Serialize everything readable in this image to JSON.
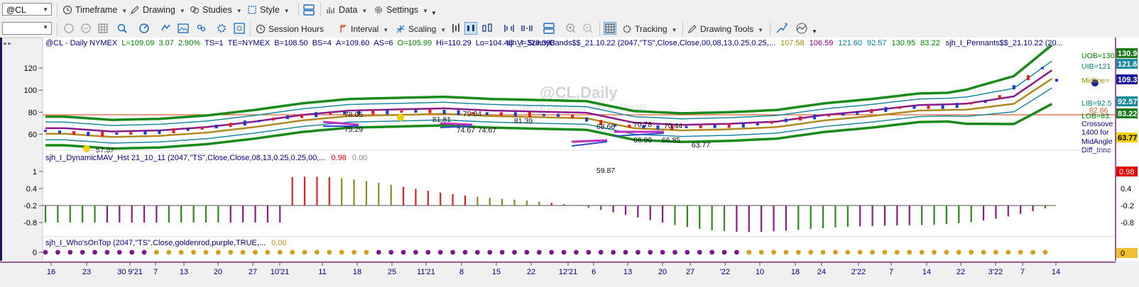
{
  "toolbar1": {
    "symbol": "@CL",
    "timeframe": "Timeframe",
    "drawing": "Drawing",
    "studies": "Studies",
    "style": "Style",
    "data": "Data",
    "settings": "Settings"
  },
  "toolbar2": {
    "session_hours": "Session Hours",
    "interval": "Interval",
    "scaling": "Scaling",
    "tracking": "Tracking",
    "drawing_tools": "Drawing Tools"
  },
  "chart": {
    "header": "@CL - Daily  NYMEX",
    "quote": [
      {
        "text": "L=109.09",
        "color": "#008000"
      },
      {
        "text": "3.07",
        "color": "#008000"
      },
      {
        "text": "2.90%",
        "color": "#008000"
      },
      {
        "text": "TS=1",
        "color": "#000080"
      },
      {
        "text": "TE=NYMEX",
        "color": "#000080"
      },
      {
        "text": "B=108.50",
        "color": "#000080"
      },
      {
        "text": "BS=4",
        "color": "#000080"
      },
      {
        "text": "A=109.60",
        "color": "#000080"
      },
      {
        "text": "AS=6",
        "color": "#000080"
      },
      {
        "text": "O=105.99",
        "color": "#008000"
      },
      {
        "text": "Hi=110.29",
        "color": "#000080"
      },
      {
        "text": "Lo=104.48",
        "color": "#000080"
      },
      {
        "text": "V=329,393",
        "color": "#000080"
      }
    ],
    "study1": "sjh_I_SunnyBands$$_21.10.22 (2047,\"TS\",Close,Close,00,08,13,0.25,0.25,...",
    "study1_values": [
      {
        "text": "107.58",
        "color": "#a09000"
      },
      {
        "text": "106.59",
        "color": "#800080"
      },
      {
        "text": "121.60",
        "color": "#0080a0"
      },
      {
        "text": "92.57",
        "color": "#0080a0"
      },
      {
        "text": "130.95",
        "color": "#008000"
      },
      {
        "text": "83.22",
        "color": "#008000"
      }
    ],
    "study1b": "sjh_I_Pennants$$_21.10.22 (20...",
    "watermark": "@CL,Daily",
    "watermark_sub": "Crude Oil Continuous Contract [Apr22]",
    "price_ticks": [
      "120",
      "100",
      "80",
      "60"
    ],
    "right_labels": [
      {
        "text": "130.9",
        "bg": "#1a7a1a"
      },
      {
        "text": "121.6",
        "bg": "#1a8aa0"
      },
      {
        "text": "109.3",
        "bg": "#1a1a9a"
      },
      {
        "text": "92.57",
        "bg": "#1a8aa0"
      },
      {
        "text": "83.22",
        "bg": "#1a7a1a"
      },
      {
        "text": "63.77",
        "bg": "#f0d000",
        "fg": "#000"
      }
    ],
    "band_labels": [
      {
        "text": "UOB=130",
        "color": "#008000"
      },
      {
        "text": "UIB=121",
        "color": "#008080"
      },
      {
        "text": "Midline=",
        "color": "#a09000"
      },
      {
        "text": "LIB=92.5",
        "color": "#008080"
      },
      {
        "text": "82.86",
        "color": "#e06030"
      },
      {
        "text": "LOB=83.",
        "color": "#008000"
      },
      {
        "text": "Crossove",
        "color": "#000080"
      },
      {
        "text": "1400 for",
        "color": "#000080"
      },
      {
        "text": "MidAngle",
        "color": "#000080"
      },
      {
        "text": "Diff_Inne",
        "color": "#000080"
      }
    ],
    "price_annotations": [
      "57.37",
      "78.05",
      "75.29",
      "81.81",
      "79.84",
      "74.67",
      "74.67",
      "81.39",
      "68.66",
      "70.78",
      "70.44",
      "59.87",
      "66.90",
      "66.85",
      "63.77"
    ],
    "study2": "sjh_I_DynamicMAV_Hst 21_10_11 (2047,\"TS\",Close,Close,08,13,0.25,0.25,00,...",
    "study2_v1": "0.98",
    "study2_v2": "0.00",
    "hist_ticks": [
      "1",
      "0.4",
      "-0.2",
      "-0.8"
    ],
    "hist_right_ticks": [
      "1",
      "0.4",
      "-0.2",
      "-0.8"
    ],
    "hist_right_label": "0.98",
    "study3": "sjh_I_Who'sOnTop (2047,\"TS\",Close,goldenrod,purple,TRUE,...",
    "study3_v": "0.00",
    "who_tick": "0",
    "who_right_label": "0",
    "date_ticks": [
      "16",
      "23",
      "30 9'21",
      "7",
      "13",
      "20",
      "27",
      "10'21",
      "11",
      "18",
      "25",
      "11'21",
      "8",
      "15",
      "22",
      "12'21",
      "6",
      "13",
      "20",
      "27",
      "'22",
      "10",
      "18",
      "24",
      "2'22",
      "7",
      "14",
      "22",
      "3'22",
      "7",
      "14"
    ]
  },
  "chart_data": {
    "type": "line",
    "title": "@CL,Daily",
    "ylim": [
      50,
      140
    ],
    "price_x": [
      0,
      10,
      20,
      30,
      40,
      50,
      60,
      70,
      80,
      90,
      100,
      110,
      120,
      130,
      140,
      150,
      160,
      170,
      180,
      190,
      200,
      210,
      213
    ],
    "price_y": [
      63,
      60,
      61,
      64,
      69,
      75,
      79,
      80,
      81,
      79,
      78,
      77,
      68,
      66,
      67,
      69,
      75,
      79,
      84,
      85,
      91,
      120,
      109
    ]
  }
}
